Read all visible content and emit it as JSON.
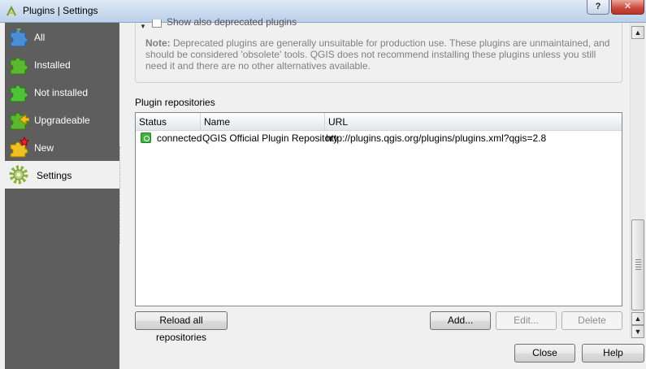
{
  "window": {
    "title": "Plugins | Settings",
    "help_btn": "?",
    "close_btn": "✕"
  },
  "sidebar": {
    "items": [
      {
        "label": "All"
      },
      {
        "label": "Installed"
      },
      {
        "label": "Not installed"
      },
      {
        "label": "Upgradeable"
      },
      {
        "label": "New"
      },
      {
        "label": "Settings"
      }
    ],
    "selected": "Settings"
  },
  "deprecated": {
    "checkbox_label": "Show also deprecated plugins",
    "checked": false,
    "note_bold": "Note:",
    "note_text": " Deprecated plugins are generally unsuitable for production use. These plugins are unmaintained, and should be considered 'obsolete' tools. QGIS does not recommend installing these plugins unless you still need it and there are no other alternatives available."
  },
  "repositories": {
    "label": "Plugin repositories",
    "columns": [
      "Status",
      "Name",
      "URL"
    ],
    "rows": [
      {
        "status": "connected",
        "name": "QGIS Official Plugin Repository",
        "url": "http://plugins.qgis.org/plugins/plugins.xml?qgis=2.8"
      }
    ]
  },
  "buttons": {
    "reload": "Reload all repositories",
    "add": "Add...",
    "edit": "Edit...",
    "delete": "Delete",
    "close": "Close",
    "help": "Help"
  },
  "scrollbar": {
    "up": "▲",
    "down": "▼"
  }
}
